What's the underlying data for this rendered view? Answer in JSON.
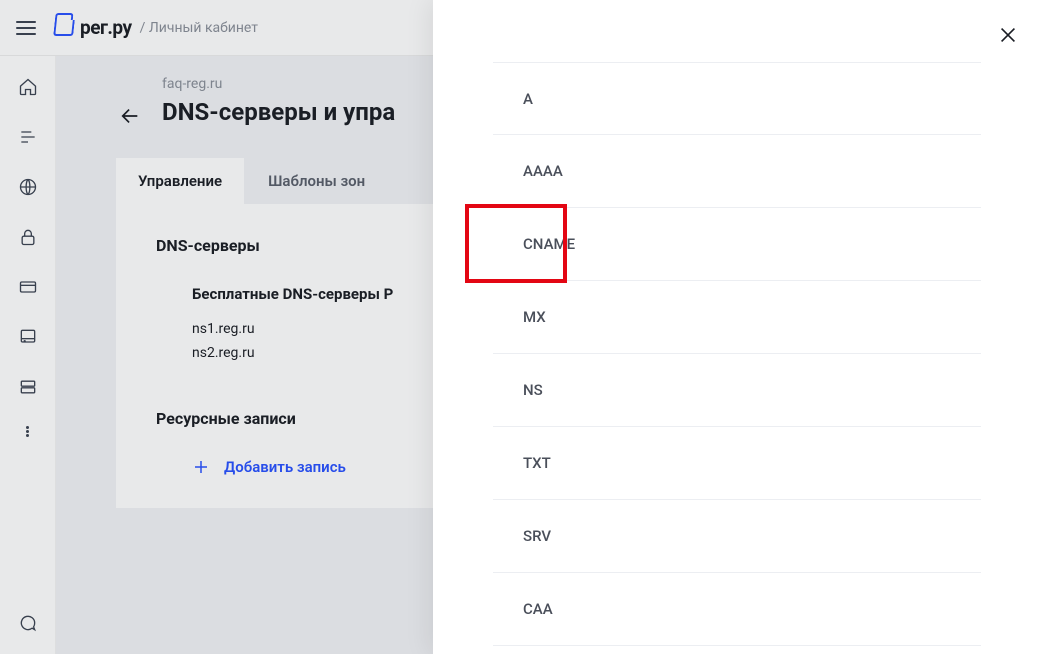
{
  "header": {
    "brand": "рег.ру",
    "breadcrumb": "/ Личный кабинет"
  },
  "page": {
    "domain": "faq-reg.ru",
    "title": "DNS-серверы и упра"
  },
  "tabs": {
    "manage": "Управление",
    "templates": "Шаблоны зон"
  },
  "dns_section": {
    "title": "DNS-серверы",
    "free_title": "Бесплатные DNS-серверы Р",
    "ns": [
      "ns1.reg.ru",
      "ns2.reg.ru"
    ]
  },
  "records_section": {
    "title": "Ресурсные записи",
    "add_label": "Добавить запись"
  },
  "record_types": [
    "A",
    "AAAA",
    "CNAME",
    "MX",
    "NS",
    "TXT",
    "SRV",
    "CAA"
  ],
  "highlighted_type": "CNAME"
}
